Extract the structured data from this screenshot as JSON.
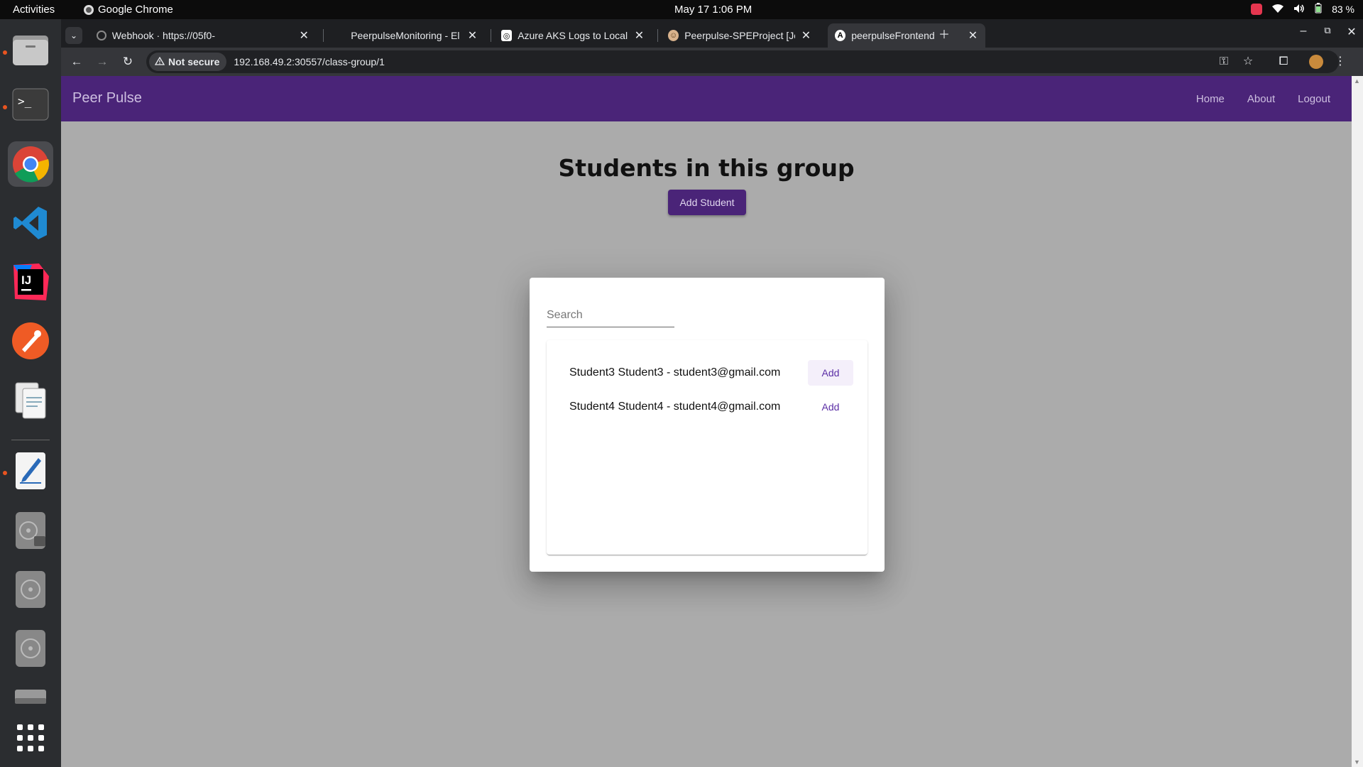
{
  "system": {
    "activities": "Activities",
    "app_name": "Google Chrome",
    "clock": "May 17  1:06 PM",
    "battery": "83 %"
  },
  "browser": {
    "tabs": [
      {
        "title": "Webhook · https://05f0-",
        "favicon": "webhook-icon"
      },
      {
        "title": "PeerpulseMonitoring - El",
        "favicon": "elastic-icon"
      },
      {
        "title": "Azure AKS Logs to Local",
        "favicon": "openai-icon"
      },
      {
        "title": "Peerpulse-SPEProject [Je",
        "favicon": "jenkins-icon"
      },
      {
        "title": "peerpulseFrontend",
        "favicon": "angular-icon",
        "active": true
      }
    ],
    "security_label": "Not secure",
    "url": "192.168.49.2:30557/class-group/1"
  },
  "navbar": {
    "brand": "Peer Pulse",
    "links": [
      "Home",
      "About",
      "Logout"
    ]
  },
  "page": {
    "heading": "Students in this group",
    "add_student_label": "Add Student"
  },
  "dialog": {
    "search_placeholder": "Search",
    "students": [
      {
        "label": "Student3 Student3 - student3@gmail.com",
        "action": "Add"
      },
      {
        "label": "Student4 Student4 - student4@gmail.com",
        "action": "Add"
      }
    ]
  },
  "colors": {
    "navbar": "#4a2478",
    "accent_text": "#5b2ea6",
    "backdrop": "#ababab"
  }
}
